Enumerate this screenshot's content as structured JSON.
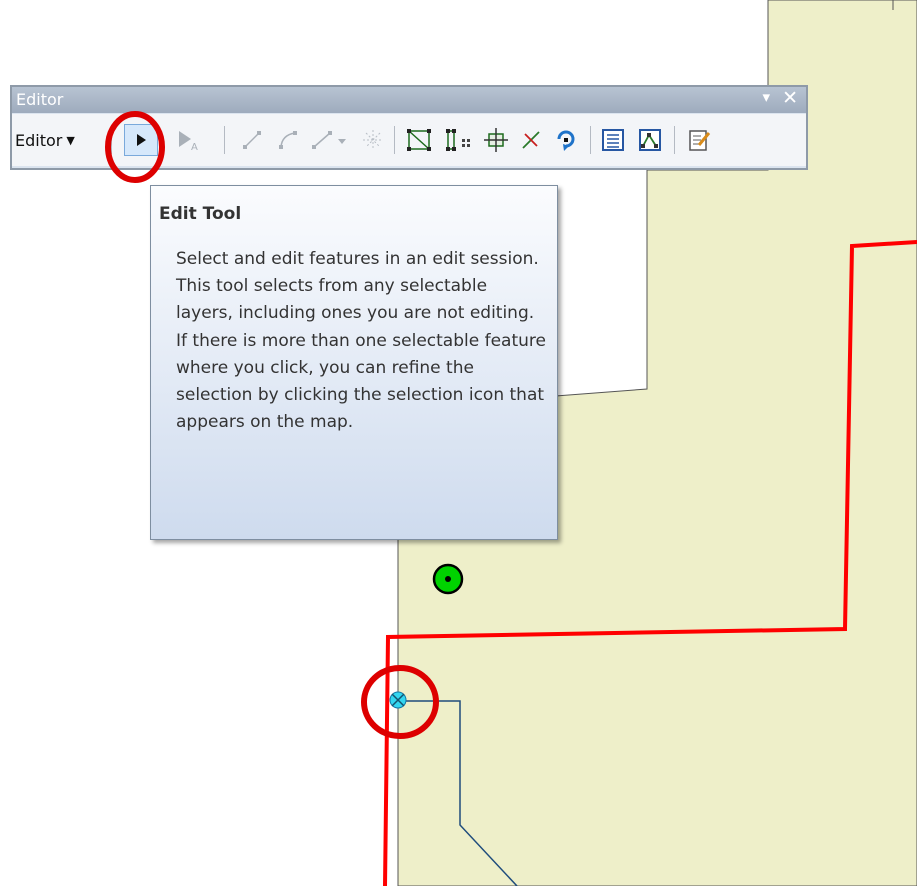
{
  "toolbar": {
    "title": "Editor",
    "menu_label": "Editor",
    "tools": [
      {
        "icon": "edit-tool-icon",
        "state": "active"
      },
      {
        "icon": "edit-annotation-tool-icon",
        "state": "disabled"
      },
      {
        "icon": "straight-segment-icon",
        "state": "disabled"
      },
      {
        "icon": "end-point-arc-segment-icon",
        "state": "disabled"
      },
      {
        "icon": "construction-tools-dropdown-icon",
        "state": "disabled"
      },
      {
        "icon": "point-at-end-of-line-icon",
        "state": "disabled"
      },
      {
        "icon": "edit-vertices-icon",
        "state": "enabled"
      },
      {
        "icon": "reshape-feature-icon",
        "state": "enabled"
      },
      {
        "icon": "cut-polygons-icon",
        "state": "enabled"
      },
      {
        "icon": "split-tool-icon",
        "state": "enabled"
      },
      {
        "icon": "rotate-tool-icon",
        "state": "enabled"
      },
      {
        "icon": "attributes-icon",
        "state": "enabled"
      },
      {
        "icon": "sketch-properties-icon",
        "state": "enabled"
      },
      {
        "icon": "create-features-icon",
        "state": "enabled"
      }
    ]
  },
  "tooltip": {
    "title": "Edit Tool",
    "body": "Select and edit features in an edit session. This tool selects from any selectable layers, including ones you are not editing. If there is more than one selectable feature where you click, you can refine the selection by clicking the selection icon that appears on the map."
  },
  "map": {
    "polygon_fill": "#eeefc9",
    "boundary_color": "#ff0000",
    "highlight_circle_color": "#dd0000",
    "line_color": "#1f4c7c",
    "point_symbol_color": "#00d200",
    "vertex_color": "#33d6f0"
  }
}
